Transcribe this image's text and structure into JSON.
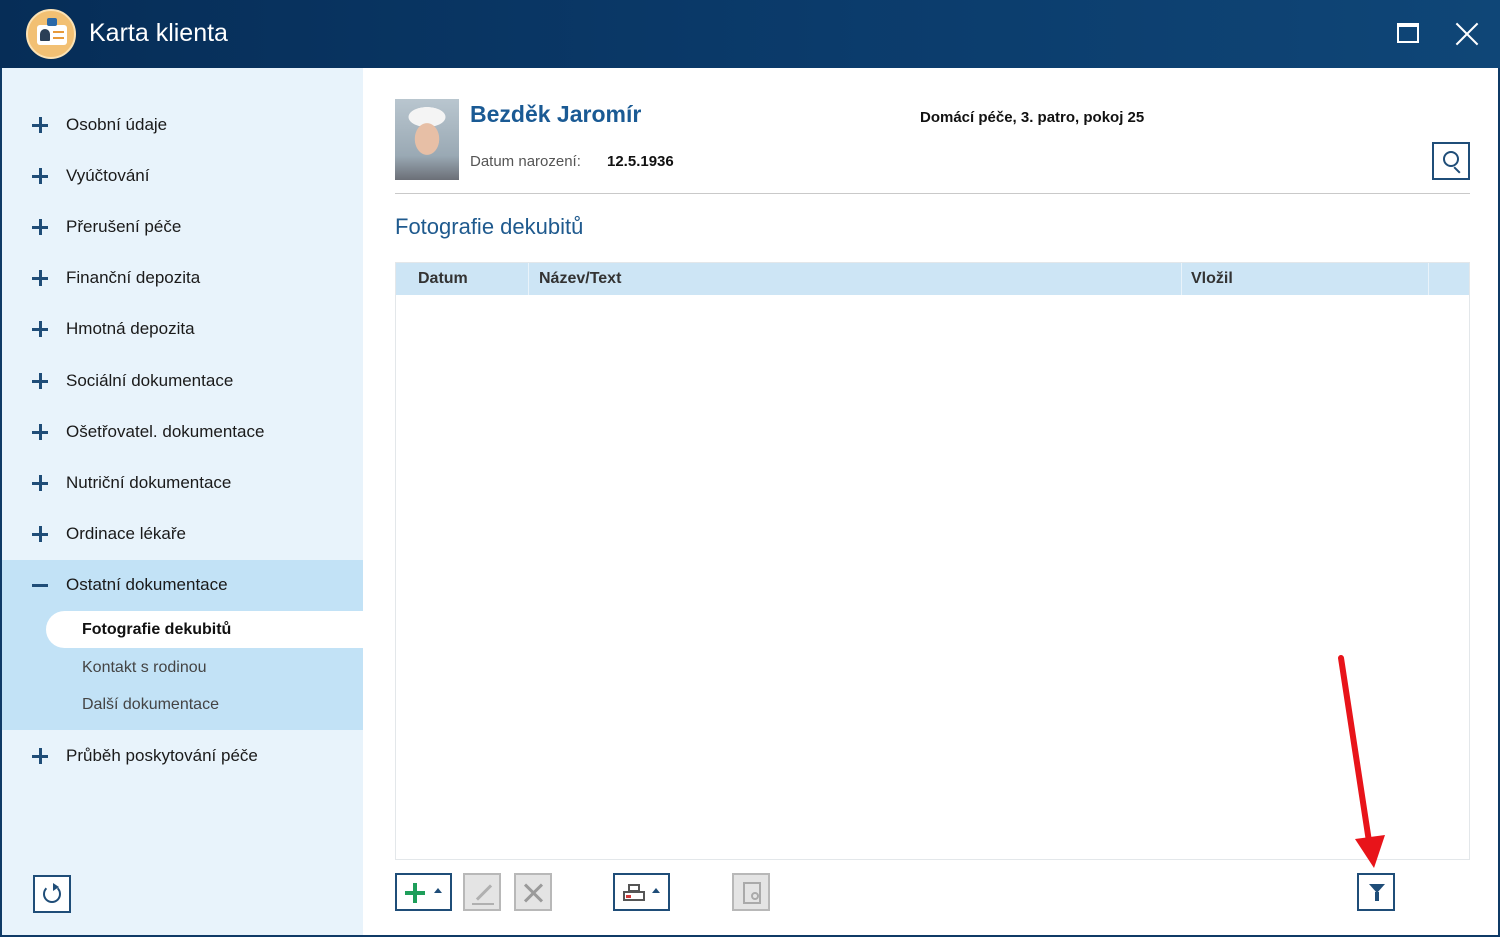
{
  "window": {
    "title": "Karta klienta"
  },
  "sidebar": {
    "items": [
      {
        "label": "Osobní údaje",
        "state": "collapsed"
      },
      {
        "label": "Vyúčtování",
        "state": "collapsed"
      },
      {
        "label": "Přerušení péče",
        "state": "collapsed"
      },
      {
        "label": "Finanční depozita",
        "state": "collapsed"
      },
      {
        "label": "Hmotná depozita",
        "state": "collapsed"
      },
      {
        "label": "Sociální dokumentace",
        "state": "collapsed"
      },
      {
        "label": "Ošetřovatel. dokumentace",
        "state": "collapsed"
      },
      {
        "label": "Nutriční dokumentace",
        "state": "collapsed"
      },
      {
        "label": "Ordinace lékaře",
        "state": "collapsed"
      },
      {
        "label": "Ostatní dokumentace",
        "state": "expanded"
      },
      {
        "label": "Průběh poskytování péče",
        "state": "collapsed"
      }
    ],
    "subitems": [
      {
        "label": "Fotografie dekubitů",
        "active": true
      },
      {
        "label": "Kontakt s rodinou",
        "active": false
      },
      {
        "label": "Další dokumentace",
        "active": false
      }
    ]
  },
  "client": {
    "name": "Bezděk Jaromír",
    "dob_label": "Datum narození:",
    "dob": "12.5.1936",
    "location": "Domácí péče, 3. patro, pokoj 25"
  },
  "section": {
    "title": "Fotografie dekubitů"
  },
  "table": {
    "columns": [
      "Datum",
      "Název/Text",
      "Vložil"
    ],
    "rows": []
  },
  "colors": {
    "titlebar": "#0b3b6b",
    "sidebar": "#e8f3fb",
    "accent": "#1f4d78",
    "header_row": "#cde5f5",
    "annotation": "#e8141a"
  },
  "icons": [
    "app-logo-icon",
    "maximize-icon",
    "close-icon",
    "plus-icon",
    "minus-icon",
    "refresh-icon",
    "search-icon",
    "add-icon",
    "edit-icon",
    "delete-icon",
    "print-icon",
    "preview-icon",
    "filter-icon"
  ]
}
